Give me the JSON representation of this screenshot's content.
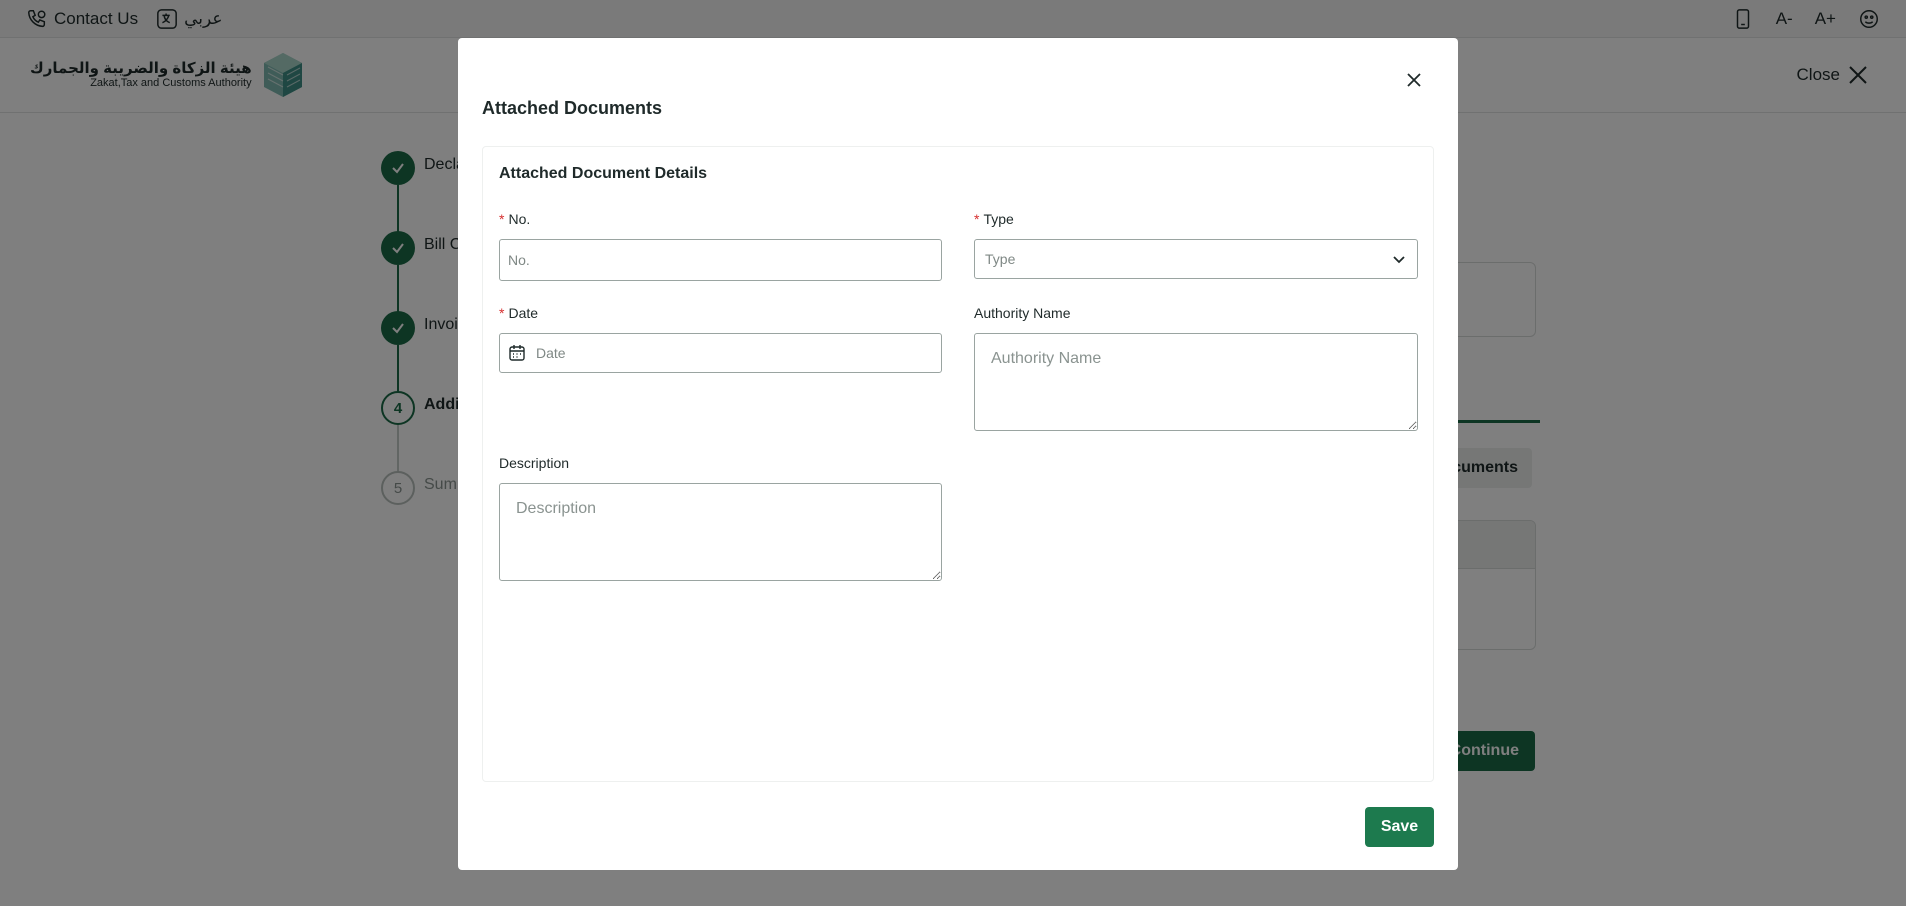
{
  "topbar": {
    "contact_label": "Contact Us",
    "language_label": "عربي",
    "font_decrease": "A-",
    "font_increase": "A+"
  },
  "header": {
    "logo_ar": "هيئة الزكاة والضريبة والجمارك",
    "logo_en": "Zakat,Tax and Customs Authority",
    "close_label": "Close"
  },
  "stepper": {
    "steps": [
      {
        "number": "1",
        "label": "Decla",
        "state": "done"
      },
      {
        "number": "2",
        "label": "Bill C",
        "state": "done"
      },
      {
        "number": "3",
        "label": "Invoi",
        "state": "done"
      },
      {
        "number": "4",
        "label": "Addi",
        "state": "current"
      },
      {
        "number": "5",
        "label": "Sum",
        "state": "todo"
      }
    ]
  },
  "background": {
    "tab_label": "cuments",
    "continue_label": "Continue"
  },
  "modal": {
    "title": "Attached Documents",
    "card_title": "Attached Document Details",
    "fields": {
      "no": {
        "label": "No.",
        "placeholder": "No.",
        "required": "*"
      },
      "type": {
        "label": "Type",
        "placeholder": "Type",
        "required": "*"
      },
      "date": {
        "label": "Date",
        "placeholder": "Date",
        "required": "*"
      },
      "authority": {
        "label": "Authority Name",
        "placeholder": "Authority Name"
      },
      "description": {
        "label": "Description",
        "placeholder": "Description"
      }
    },
    "save_label": "Save"
  },
  "colors": {
    "primary": "#1d7a4e",
    "step_done": "#1b6b47",
    "required": "#d62f2f"
  },
  "icons": [
    "phone-icon",
    "language-icon",
    "mobile-icon",
    "font-decrease-icon",
    "font-increase-icon",
    "contrast-icon",
    "close-icon",
    "check-icon",
    "chevron-down-icon",
    "calendar-icon"
  ]
}
